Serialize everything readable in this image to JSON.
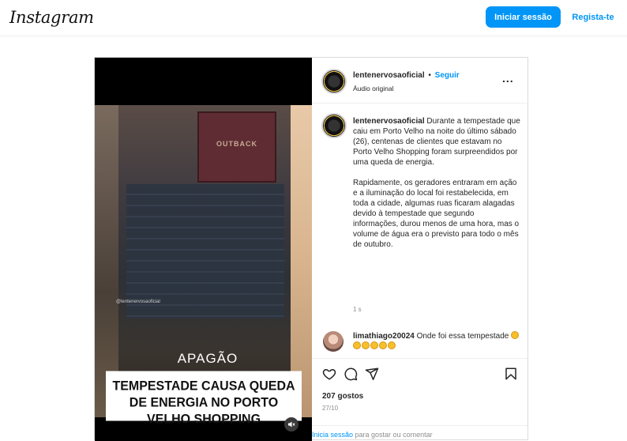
{
  "header": {
    "logo": "Instagram",
    "login_label": "Iniciar sessão",
    "register_label": "Regista-te"
  },
  "video": {
    "watermark": "@lentenervosaoficial",
    "sign_text": "OUTBACK",
    "label": "APAGÃO",
    "headline": "TEMPESTADE CAUSA QUEDA DE ENERGIA NO PORTO VELHO SHOPPING",
    "mute_icon": "speaker-off-icon"
  },
  "post": {
    "username": "lentenervosaoficial",
    "separator": "•",
    "follow_label": "Seguir",
    "audio_label": "Áudio original",
    "more_label": "...",
    "caption_username": "lentenervosaoficial",
    "caption_text": " Durante a tempestade que caiu em Porto Velho na noite do último sábado (26), centenas de clientes que estavam no Porto Velho Shopping foram surpreendidos por uma queda de energia.\n\nRapidamente, os geradores entraram em ação e a iluminação do local foi restabelecida, em toda a cidade, algumas ruas ficaram alagadas devido à tempestade que segundo informações, durou menos de uma hora, mas o volume de água era o previsto para todo o mês de outubro.",
    "caption_time": "1 s",
    "comment": {
      "username": "limathiago20024",
      "text": " Onde foi essa tempestade "
    },
    "likes": "207 gostos",
    "date": "27/10",
    "footer_link": "Inicia sessão",
    "footer_text": " para gostar ou comentar"
  },
  "colors": {
    "accent": "#0095f6",
    "text": "#262626",
    "muted": "#8e8e8e"
  }
}
